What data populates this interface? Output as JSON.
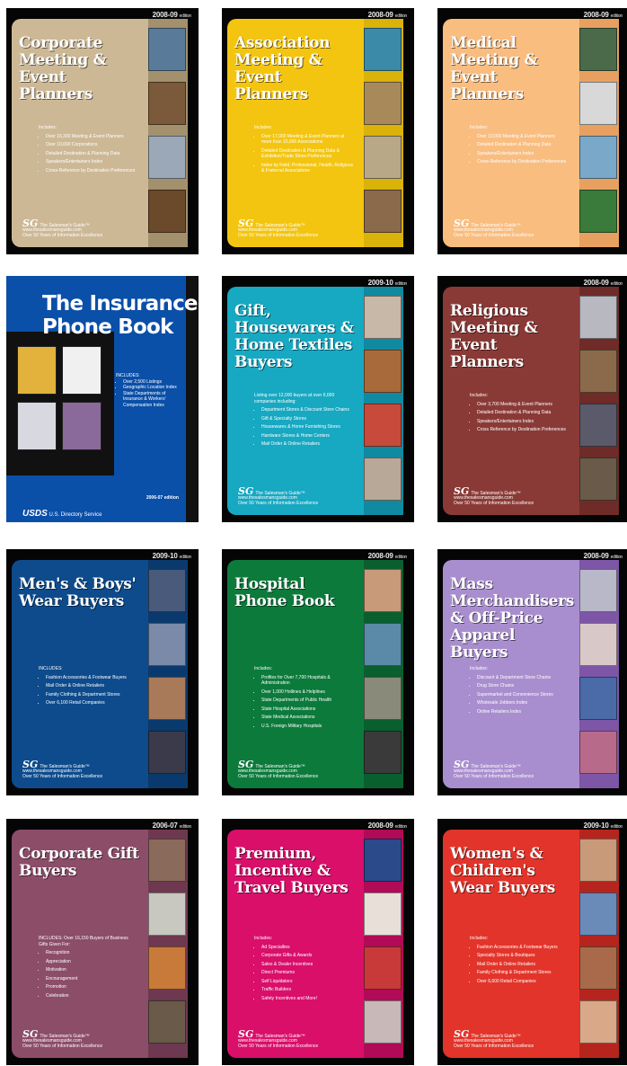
{
  "publisher_logo": "SG",
  "publisher_text": "The Salesman's Guide™",
  "publisher_url": "www.thesalesmansguide.com",
  "publisher_tagline": "Over 50 Years of Information Excellence",
  "books": [
    {
      "edition": "2008-09",
      "edition_suffix": "edition",
      "title": "Corporate Meeting & Event Planners",
      "includes_label": "Includes:",
      "items": [
        "Over 16,300 Meeting & Event Planners",
        "Over 10,000 Corporations",
        "Detailed Destination & Planning Data",
        "Speakers/Entertainers Index",
        "Cross-Reference by Destination Preferences"
      ]
    },
    {
      "edition": "2008-09",
      "edition_suffix": "edition",
      "title": "Association Meeting & Event Planners",
      "includes_label": "Includes:",
      "items": [
        "Over 17,000 Meeting & Event Planners at more than 10,000 Associations",
        "Detailed Destination & Planning Data & Exhibition/Trade Show Preferences",
        "Index by Field, Professional, Health, Religious & Fraternal Associations"
      ]
    },
    {
      "edition": "2008-09",
      "edition_suffix": "edition",
      "title": "Medical Meeting & Event Planners",
      "includes_label": "Includes:",
      "items": [
        "Over 10,000 Meeting & Event Planners",
        "Detailed Destination & Planning Data",
        "Speakers/Entertainers Index",
        "Cross-Reference by Destination Preferences"
      ]
    },
    {
      "edition": "",
      "edition_suffix": "",
      "title": "The Insurance Phone Book",
      "includes_label": "INCLUDES:",
      "items": [
        "Over 2,500 Listings",
        "Geographic Location Index",
        "State Departments of Insurance & Workers' Compensation Index"
      ],
      "bottom_edition": "2006-07 edition",
      "usds": "USDS",
      "usds_text": "U.S. Directory Service"
    },
    {
      "edition": "2009-10",
      "edition_suffix": "edition",
      "title": "Gift, Housewares & Home Textiles Buyers",
      "includes_label": "Listing over 12,000 buyers at over 6,000 companies including:",
      "items": [
        "Department Stores & Discount Store Chains",
        "Gift & Specialty Stores",
        "Housewares & Home Furnishing Stores",
        "Hardware Stores & Home Centers",
        "Mail Order & Online Retailers"
      ]
    },
    {
      "edition": "2008-09",
      "edition_suffix": "edition",
      "title": "Religious Meeting & Event Planners",
      "includes_label": "Includes:",
      "items": [
        "Over 3,700 Meeting & Event Planners",
        "Detailed Destination & Planning Data",
        "Speakers/Entertainers Index",
        "Cross Reference by Destination Preferences"
      ]
    },
    {
      "edition": "2009-10",
      "edition_suffix": "edition",
      "title": "Men's & Boys' Wear Buyers",
      "includes_label": "INCLUDES:",
      "items": [
        "Fashion Accessories & Footwear Buyers",
        "Mail Order & Online Retailers",
        "Family Clothing & Department Stores",
        "Over 6,100 Retail Companies"
      ]
    },
    {
      "edition": "2008-09",
      "edition_suffix": "edition",
      "title": "Hospital Phone Book",
      "includes_label": "Includes:",
      "items": [
        "Profiles for Over 7,700 Hospitals & Administration",
        "Over 1,000 Hotlines & Helplines",
        "State Departments of Public Health",
        "State Hospital Associations",
        "State Medical Associations",
        "U.S. Foreign Military Hospitals"
      ]
    },
    {
      "edition": "2008-09",
      "edition_suffix": "edition",
      "title": "Mass Merchandisers & Off-Price Apparel Buyers",
      "includes_label": "Includes:",
      "items": [
        "Discount & Department Store Chains",
        "Drug Store Chains",
        "Supermarket and Convenience Stores",
        "Wholesale Jobbers Index",
        "Online Retailers Index"
      ]
    },
    {
      "edition": "2006-07",
      "edition_suffix": "edition",
      "title": "Corporate Gift Buyers",
      "includes_label": "INCLUDES: Over 16,150 Buyers of Business Gifts Given For:",
      "items": [
        "Recognition",
        "Appreciation",
        "Motivation",
        "Encouragement",
        "Promotion",
        "Celebration"
      ]
    },
    {
      "edition": "2008-09",
      "edition_suffix": "edition",
      "title": "Premium, Incentive & Travel Buyers",
      "includes_label": "Includes:",
      "items": [
        "Ad Specialties",
        "Corporate Gifts & Awards",
        "Sales & Dealer Incentives",
        "Direct Premiums",
        "Self Liquidators",
        "Traffic Builders",
        "Safety Incentives and More!"
      ]
    },
    {
      "edition": "2009-10",
      "edition_suffix": "edition",
      "title": "Women's & Children's Wear Buyers",
      "includes_label": "Includes:",
      "items": [
        "Fashion Accessories & Footwear Buyers",
        "Specialty Stores & Boutiques",
        "Mail Order & Online Retailers",
        "Family Clothing & Department Stores",
        "Over 6,600 Retail Companies"
      ]
    }
  ],
  "colors": {
    "panels": [
      "#cdb896",
      "#f3c511",
      "#f9bd80",
      "#0a4fa8",
      "#17a8c2",
      "#8a3a36",
      "#0d4b8c",
      "#0c7a3b",
      "#a98ecf",
      "#8c4d69",
      "#d90f6a",
      "#e2342a"
    ],
    "strips": [
      "#a3906c",
      "#d9b20a",
      "#e8a060",
      "#0a4fa8",
      "#0f8aa1",
      "#6e2b28",
      "#0a3a6d",
      "#095f2e",
      "#7d56a7",
      "#6e3850",
      "#b10a56",
      "#b5251e"
    ]
  }
}
